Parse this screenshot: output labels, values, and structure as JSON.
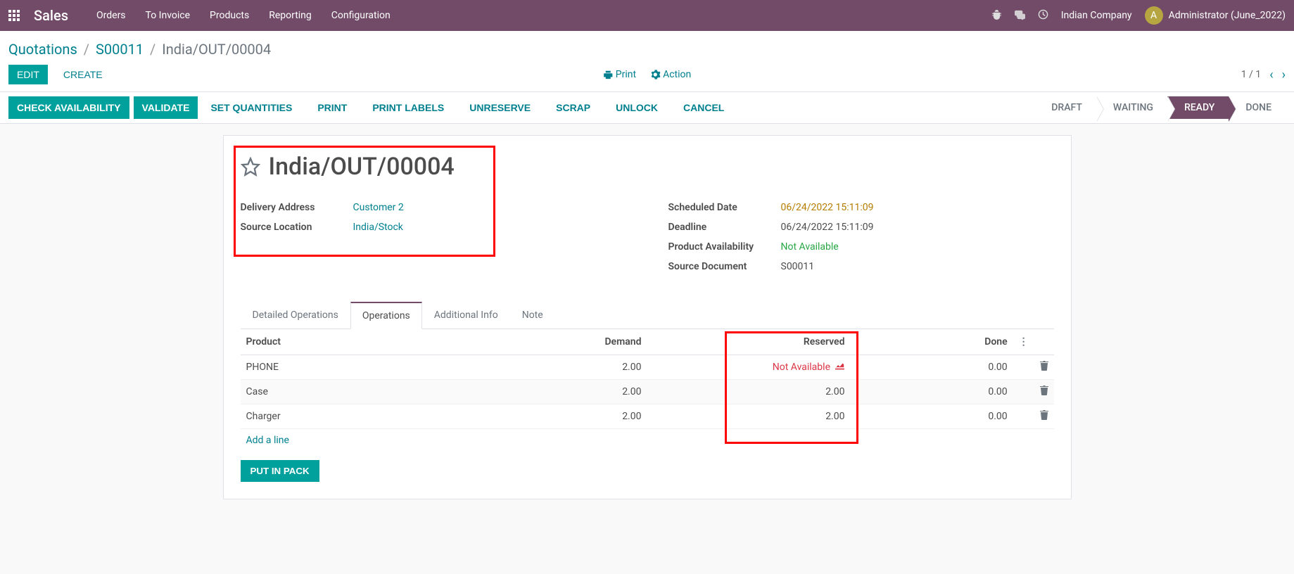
{
  "navbar": {
    "brand": "Sales",
    "menu": [
      "Orders",
      "To Invoice",
      "Products",
      "Reporting",
      "Configuration"
    ],
    "company": "Indian Company",
    "avatar_initial": "A",
    "user": "Administrator (June_2022)"
  },
  "breadcrumb": {
    "items": [
      "Quotations",
      "S00011"
    ],
    "current": "India/OUT/00004"
  },
  "cp": {
    "edit": "EDIT",
    "create": "CREATE",
    "print": "Print",
    "action": "Action",
    "pager": "1 / 1"
  },
  "statusbar": {
    "actions": [
      "CHECK AVAILABILITY",
      "VALIDATE",
      "SET QUANTITIES",
      "PRINT",
      "PRINT LABELS",
      "UNRESERVE",
      "SCRAP",
      "UNLOCK",
      "CANCEL"
    ],
    "stages": [
      "DRAFT",
      "WAITING",
      "READY",
      "DONE"
    ],
    "active_stage": "READY"
  },
  "form": {
    "title": "India/OUT/00004",
    "left": {
      "delivery_address_label": "Delivery Address",
      "delivery_address": "Customer 2",
      "source_location_label": "Source Location",
      "source_location": "India/Stock"
    },
    "right": {
      "scheduled_date_label": "Scheduled Date",
      "scheduled_date": "06/24/2022 15:11:09",
      "deadline_label": "Deadline",
      "deadline": "06/24/2022 15:11:09",
      "availability_label": "Product Availability",
      "availability": "Not Available",
      "source_doc_label": "Source Document",
      "source_doc": "S00011"
    }
  },
  "tabs": [
    "Detailed Operations",
    "Operations",
    "Additional Info",
    "Note"
  ],
  "active_tab": "Operations",
  "table": {
    "headers": [
      "Product",
      "Demand",
      "Reserved",
      "Done"
    ],
    "rows": [
      {
        "product": "PHONE",
        "demand": "2.00",
        "reserved": "Not Available",
        "reserved_na": true,
        "done": "0.00"
      },
      {
        "product": "Case",
        "demand": "2.00",
        "reserved": "2.00",
        "reserved_na": false,
        "done": "0.00"
      },
      {
        "product": "Charger",
        "demand": "2.00",
        "reserved": "2.00",
        "reserved_na": false,
        "done": "0.00"
      }
    ],
    "add_line": "Add a line",
    "put_in_pack": "PUT IN PACK"
  }
}
